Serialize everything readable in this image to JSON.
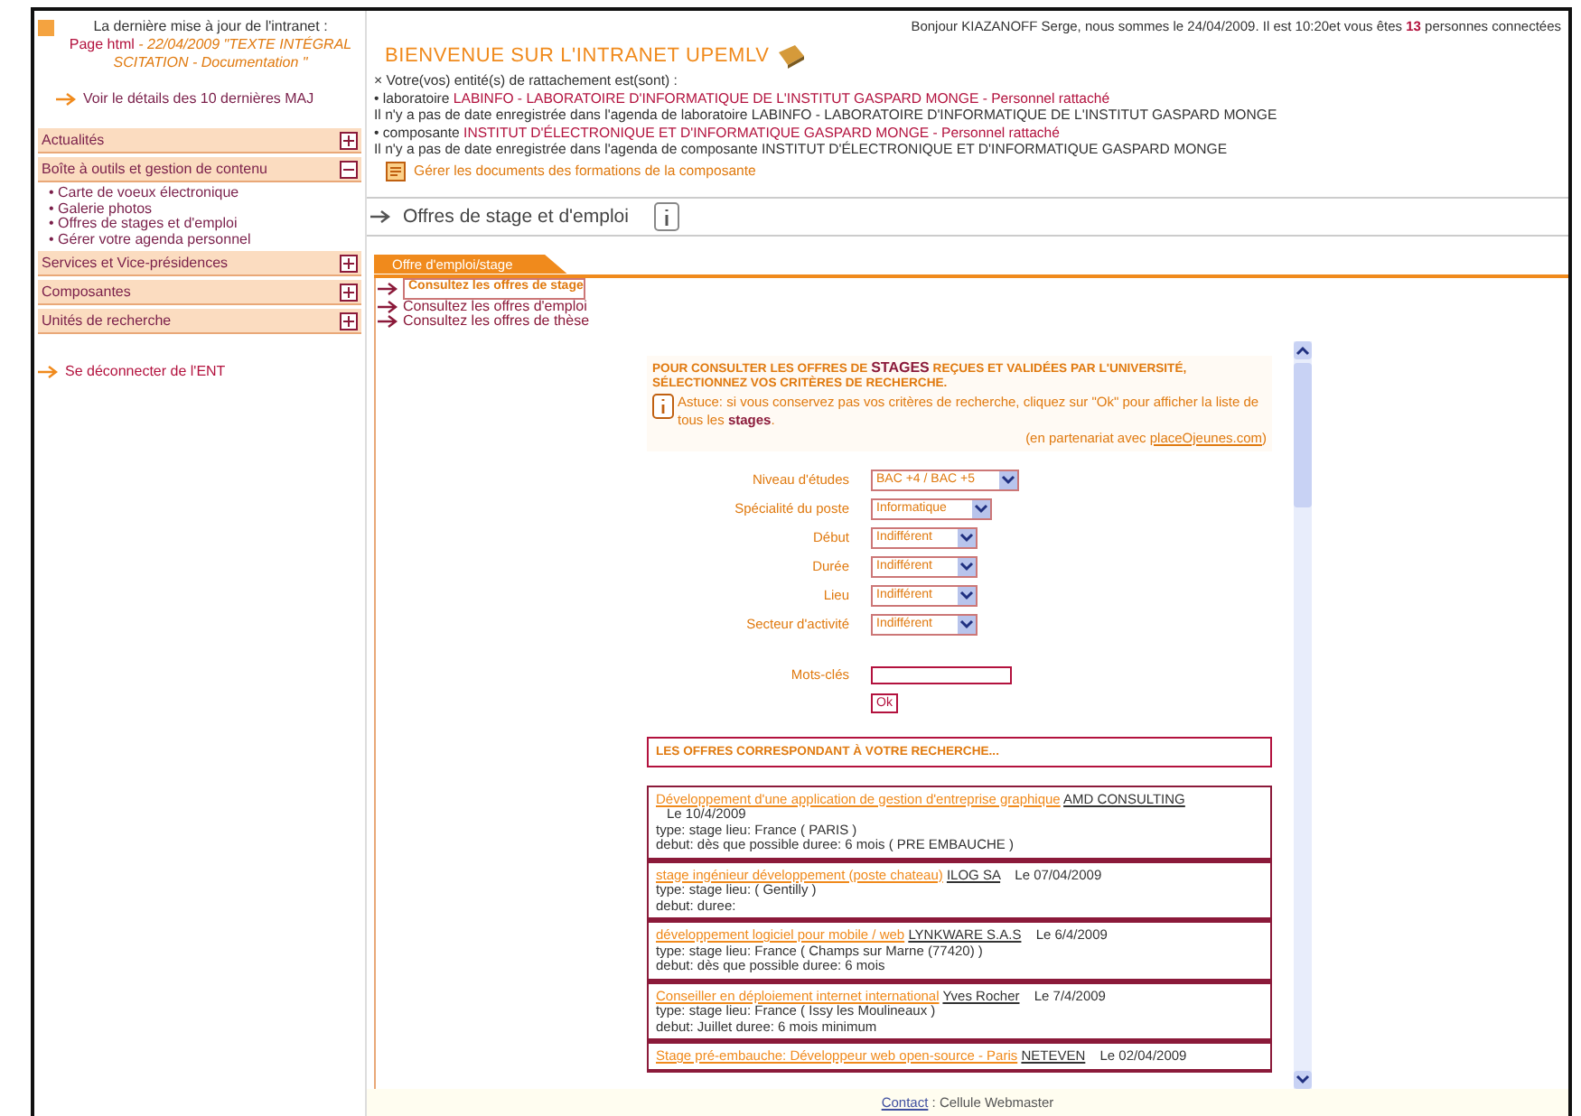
{
  "last_update": {
    "line1": "La dernière mise à jour de l'intranet :",
    "page": "Page html",
    "rest": " - 22/04/2009 \"TEXTE INTÉGRAL SCITATION - Documentation \""
  },
  "details_link": "Voir le détails des 10 dernières MAJ",
  "sidebar": {
    "sections": [
      {
        "label": "Actualités",
        "expanded": false
      },
      {
        "label": "Boîte à outils et gestion de contenu",
        "expanded": true,
        "children": [
          "• Carte de voeux électronique",
          "• Galerie photos",
          "• Offres de stages et d'emploi",
          "• Gérer votre agenda personnel"
        ]
      },
      {
        "label": "Services et Vice-présidences",
        "expanded": false
      },
      {
        "label": "Composantes",
        "expanded": false
      },
      {
        "label": "Unités de recherche",
        "expanded": false
      }
    ]
  },
  "logout": "Se déconnecter de l'ENT",
  "greeting": {
    "before": "Bonjour KIAZANOFF Serge, nous sommes le 24/04/2009. Il est 10:20et vous êtes",
    "count": "13",
    "after": "personnes connectées"
  },
  "welcome": "BIENVENUE SUR L'INTRANET UPEMLV",
  "entities_intro": "× Votre(vos) entité(s) de rattachement est(sont) :",
  "entity_lines": [
    {
      "kind": "attachment",
      "prefix": "• laboratoire",
      "name": "LABINFO - LABORATOIRE D'INFORMATIQUE DE L'INSTITUT GASPARD MONGE - Personnel rattaché"
    },
    {
      "kind": "note",
      "text": "Il n'y a pas de date enregistrée dans l'agenda de laboratoire LABINFO - LABORATOIRE D'INFORMATIQUE DE L'INSTITUT GASPARD MONGE"
    },
    {
      "kind": "attachment",
      "prefix": "• composante",
      "name": "INSTITUT D'ÉLECTRONIQUE ET D'INFORMATIQUE GASPARD MONGE - Personnel rattaché"
    },
    {
      "kind": "note",
      "text": "Il n'y a pas de date enregistrée dans l'agenda de composante INSTITUT D'ÉLECTRONIQUE ET D'INFORMATIQUE GASPARD MONGE"
    }
  ],
  "manage_link": "Gérer les documents des formations de la composante",
  "section_title": "Offres de stage et d'emploi",
  "tab": {
    "label": "Offre d'emploi/stage",
    "selected": true
  },
  "offer_links": [
    {
      "label": "Consultez les offres de stage",
      "selected": true
    },
    {
      "label": "Consultez les offres d'emploi",
      "selected": false
    },
    {
      "label": "Consultez les offres de thèse",
      "selected": false
    }
  ],
  "search": {
    "heading": "POUR CONSULTER LES OFFRES DE **STAGES** REÇUES ET VALIDÉES PAR L'UNIVERSITÉ, SÉLECTIONNEZ VOS CRITÈRES DE RECHERCHE.",
    "tip": "Astuce: si vous conservez pas vos critères de recherche, cliquez sur \"Ok\" pour afficher la liste de tous les **stages**.",
    "partner_before": "(en partenariat avec",
    "partner_link": "placeOjeunes.com",
    "partner_after": ")",
    "fields": [
      {
        "label": "Niveau d'études",
        "value": "BAC +4 / BAC +5"
      },
      {
        "label": "Spécialité du poste",
        "value": "Informatique"
      },
      {
        "label": "Début",
        "value": "Indifférent"
      },
      {
        "label": "Durée",
        "value": "Indifférent"
      },
      {
        "label": "Lieu",
        "value": "Indifférent"
      },
      {
        "label": "Secteur d'activité",
        "value": "Indifférent"
      }
    ],
    "keywords_label": "Mots-clés",
    "ok": "Ok"
  },
  "results_heading": "LES OFFRES CORRESPONDANT À VOTRE RECHERCHE...",
  "offers": [
    {
      "title": "Développement d'une application de gestion d'entreprise graphique",
      "company": "AMD CONSULTING",
      "date": "Le 10/4/2009",
      "type_line": "type: stage   lieu: France ( PARIS )",
      "start_line": "debut: dès que possible   duree: 6 mois ( PRE EMBAUCHE )"
    },
    {
      "title": "stage ingénieur développement (poste chateau)",
      "company": "ILOG SA",
      "date": "Le 07/04/2009",
      "type_line": "type: stage   lieu: ( Gentilly )",
      "start_line": "debut:    duree:"
    },
    {
      "title": "développement logiciel pour mobile / web",
      "company": "LYNKWARE S.A.S",
      "date": "Le 6/4/2009",
      "type_line": "type: stage   lieu: France ( Champs sur Marne (77420) )",
      "start_line": "debut: dès que possible   duree: 6 mois"
    },
    {
      "title": "Conseiller en déploiement internet international",
      "company": "Yves Rocher",
      "date": "Le 7/4/2009",
      "type_line": "type: stage   lieu: France ( Issy les Moulineaux )",
      "start_line": "debut: Juillet   duree: 6 mois minimum"
    },
    {
      "title": "Stage pré-embauche: Développeur web open-source - Paris",
      "company": "NETEVEN",
      "date": "Le 02/04/2009"
    }
  ],
  "footer": {
    "link": "Contact",
    "rest": ": Cellule Webmaster"
  }
}
